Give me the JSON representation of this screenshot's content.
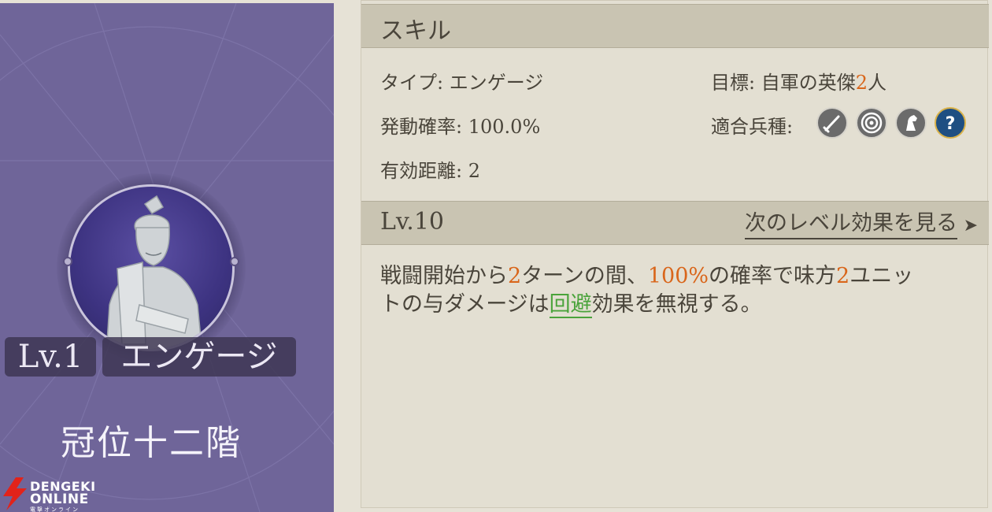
{
  "card": {
    "level": "Lv.1",
    "type_tag": "エンゲージ",
    "skill_name": "冠位十二階"
  },
  "logo": {
    "line1": "DENGEKI",
    "line2": "ONLINE",
    "line3": "電撃オンライン"
  },
  "skill_panel": {
    "title": "スキル",
    "type_label": "タイプ:",
    "type_value": "エンゲージ",
    "rate_label": "発動確率:",
    "rate_value": "100.0%",
    "range_label": "有効距離:",
    "range_value": "2",
    "target_label": "目標:",
    "target_prefix": "自軍の英傑",
    "target_count": "2",
    "target_suffix": "人",
    "troops_label": "適合兵種:",
    "troop_icons": [
      "sword-icon",
      "target-icon",
      "horse-icon",
      "question-icon"
    ],
    "level_header": "Lv.10",
    "next_level_link": "次のレベル効果を見る",
    "desc": {
      "p1": "戦闘開始から",
      "n1": "2",
      "p2": "ターンの間、",
      "n2": "100%",
      "p3": "の確率で味方",
      "n3": "2",
      "p4": "ユニッ",
      "p5": "トの与ダメージは",
      "keyword": "回避",
      "p6": "効果を無視する。"
    }
  },
  "colors": {
    "card_bg": "#6f6599",
    "panel_bg": "#e3dfd2",
    "header_bg": "#c9c4b2",
    "accent_orange": "#d9661b",
    "accent_green": "#4aa33b"
  }
}
